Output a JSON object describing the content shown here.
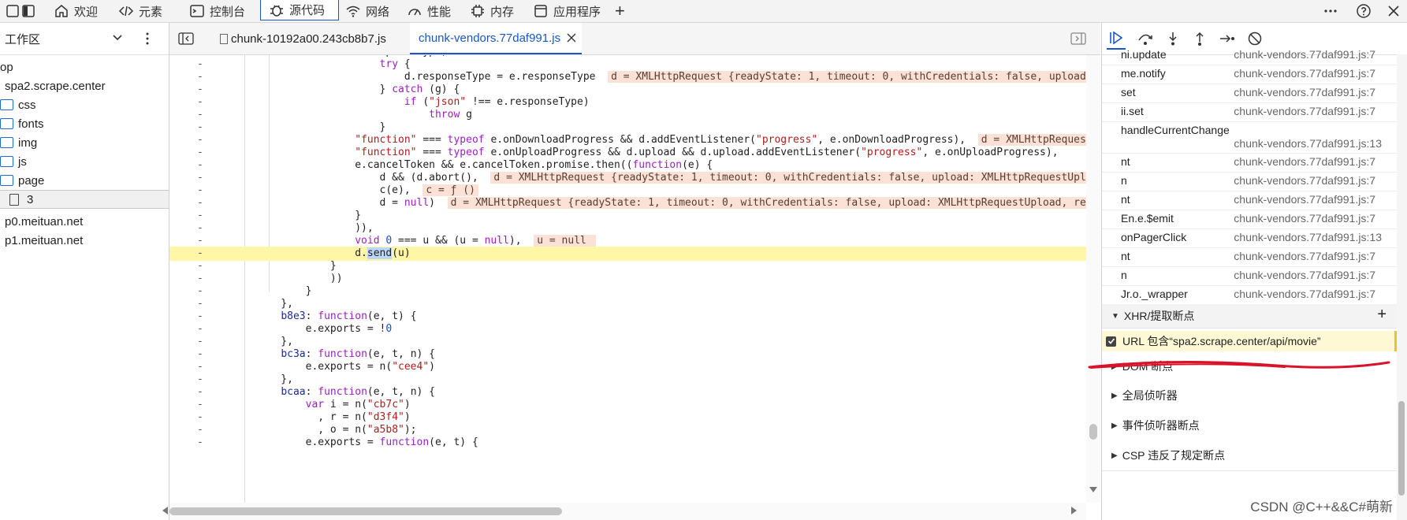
{
  "toolbar": {
    "tabs": [
      {
        "label": "欢迎",
        "icon": "home-icon"
      },
      {
        "label": "元素",
        "icon": "code-icon"
      },
      {
        "label": "控制台",
        "icon": "console-icon"
      },
      {
        "label": "源代码",
        "icon": "bug-icon"
      },
      {
        "label": "网络",
        "icon": "wifi-icon"
      },
      {
        "label": "性能",
        "icon": "gauge-icon"
      },
      {
        "label": "内存",
        "icon": "chip-icon"
      },
      {
        "label": "应用程序",
        "icon": "app-icon"
      }
    ],
    "active_tab": "源代码",
    "plus": "+"
  },
  "navigator": {
    "title": "工作区",
    "tree": [
      {
        "label": "op",
        "type": "text"
      },
      {
        "label": "spa2.scrape.center",
        "type": "text"
      },
      {
        "label": "css",
        "type": "folder"
      },
      {
        "label": "fonts",
        "type": "folder"
      },
      {
        "label": "img",
        "type": "folder"
      },
      {
        "label": "js",
        "type": "folder"
      },
      {
        "label": "page",
        "type": "folder"
      },
      {
        "label": "3",
        "type": "file",
        "selected": true
      },
      {
        "label": "p0.meituan.net",
        "type": "text"
      },
      {
        "label": "p1.meituan.net",
        "type": "text"
      }
    ]
  },
  "editor": {
    "tabs": [
      {
        "label": "chunk-10192a00.243cb8b7.js",
        "active": false
      },
      {
        "label": "chunk-vendors.77daf991.js",
        "active": true
      }
    ]
  },
  "callstack": [
    {
      "name": "ni.update",
      "loc": "chunk-vendors.77daf991.js:7"
    },
    {
      "name": "me.notify",
      "loc": "chunk-vendors.77daf991.js:7"
    },
    {
      "name": "set",
      "loc": "chunk-vendors.77daf991.js:7"
    },
    {
      "name": "ii.set",
      "loc": "chunk-vendors.77daf991.js:7"
    },
    {
      "name": "handleCurrentChange",
      "loc": "chunk-vendors.77daf991.js:13"
    },
    {
      "name": "nt",
      "loc": "chunk-vendors.77daf991.js:7"
    },
    {
      "name": "n",
      "loc": "chunk-vendors.77daf991.js:7"
    },
    {
      "name": "nt",
      "loc": "chunk-vendors.77daf991.js:7"
    },
    {
      "name": "En.e.$emit",
      "loc": "chunk-vendors.77daf991.js:7"
    },
    {
      "name": "onPagerClick",
      "loc": "chunk-vendors.77daf991.js:13"
    },
    {
      "name": "nt",
      "loc": "chunk-vendors.77daf991.js:7"
    },
    {
      "name": "n",
      "loc": "chunk-vendors.77daf991.js:7"
    },
    {
      "name": "Jr.o._wrapper",
      "loc": "chunk-vendors.77daf991.js:7"
    }
  ],
  "sections": {
    "xhr_title": "XHR/提取断点",
    "xhr_plus": "+",
    "xhr_entry": "URL 包含“spa2.scrape.center/api/movie”",
    "dom": "DOM 断点",
    "global": "全局侦听器",
    "event": "事件侦听器断点",
    "csp": "CSP 违反了规定断点"
  },
  "watermark": "CSDN @C++&&C#萌新",
  "colors": {
    "accent": "#1a56c7",
    "highlight": "#fff6a6",
    "badge": "#fbe1d6",
    "annotation": "#d9142a"
  }
}
